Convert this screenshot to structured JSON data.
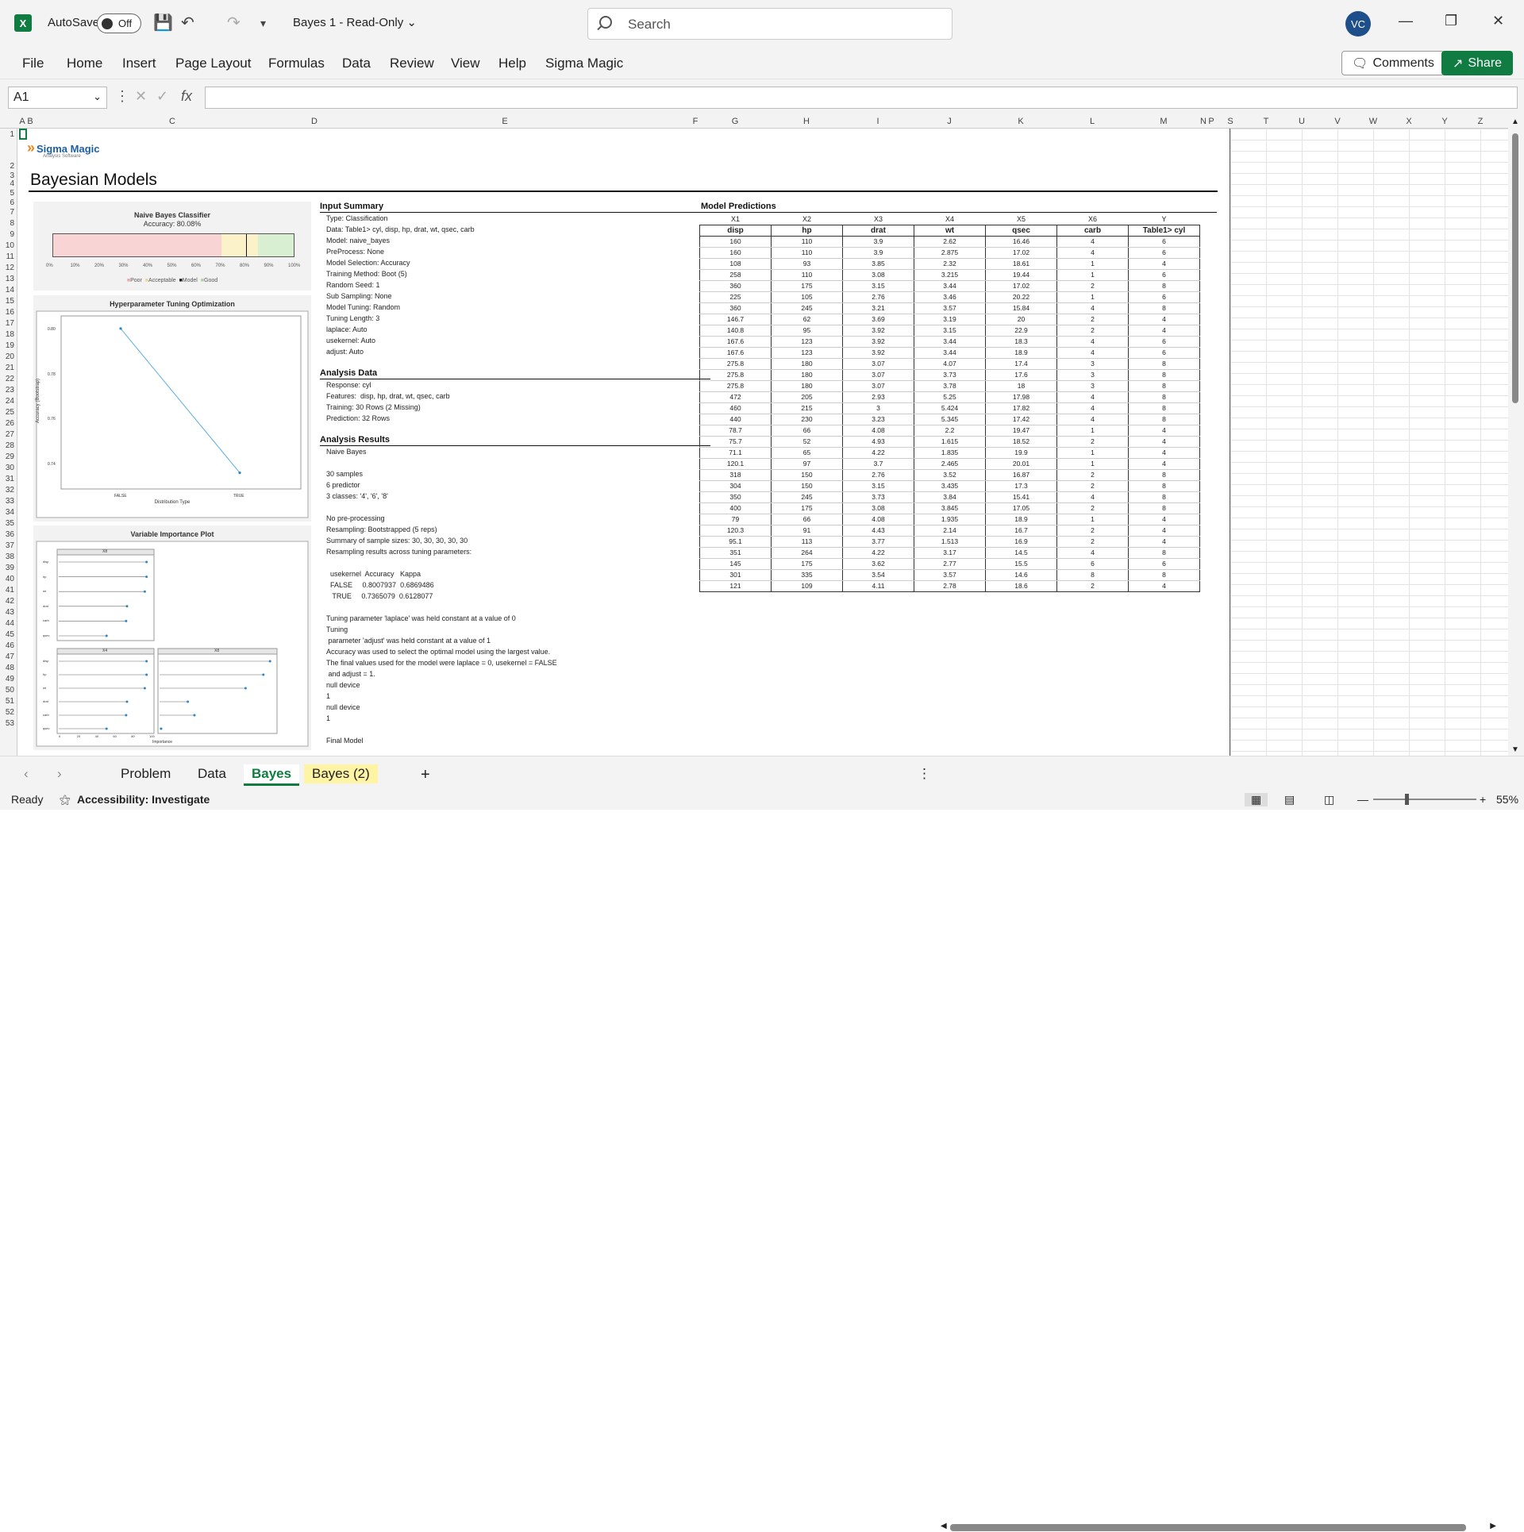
{
  "app": {
    "autosave_label": "AutoSave",
    "toggle_state": "Off",
    "doc_title": "Bayes 1  -  Read-Only",
    "search_placeholder": "Search",
    "user_initials": "VC"
  },
  "menu": [
    "File",
    "Home",
    "Insert",
    "Page Layout",
    "Formulas",
    "Data",
    "Review",
    "View",
    "Help",
    "Sigma Magic"
  ],
  "actions": {
    "comments": "Comments",
    "share": "Share"
  },
  "formula": {
    "cell": "A1",
    "fx": "fx",
    "value": ""
  },
  "columns": [
    "A",
    "B",
    "C",
    "D",
    "E",
    "F",
    "G",
    "H",
    "I",
    "J",
    "K",
    "L",
    "M",
    "N",
    "P",
    "S",
    "T",
    "U",
    "V",
    "W",
    "X",
    "Y",
    "Z"
  ],
  "rows": [
    "1",
    "2",
    "3",
    "4",
    "5",
    "6",
    "7",
    "8",
    "9",
    "10",
    "11",
    "12",
    "13",
    "14",
    "15",
    "16",
    "17",
    "18",
    "19",
    "20",
    "21",
    "22",
    "23",
    "24",
    "25",
    "26",
    "27",
    "28",
    "29",
    "30",
    "31",
    "32",
    "33",
    "34",
    "35",
    "36",
    "37",
    "38",
    "39",
    "40",
    "41",
    "42",
    "43",
    "44",
    "45",
    "46",
    "47",
    "48",
    "49",
    "50",
    "51",
    "52",
    "53"
  ],
  "sheet": {
    "logo_name": "Sigma Magic",
    "logo_sub": "Analysis Software",
    "title": "Bayesian Models",
    "gauge": {
      "title": "Naive Bayes Classifier",
      "subtitle": "Accuracy: 80.08%",
      "accuracy": 0.8008,
      "ticks": [
        "0%",
        "10%",
        "20%",
        "30%",
        "40%",
        "50%",
        "60%",
        "70%",
        "80%",
        "90%",
        "100%"
      ],
      "legend": [
        "Poor",
        "Acceptable",
        "Model",
        "Good"
      ]
    },
    "tuning_chart": {
      "title": "Hyperparameter Tuning Optimization",
      "xlabel": "Distribution Type",
      "ylabel": "Accuracy (Bootstrap)",
      "x": [
        "FALSE",
        "TRUE"
      ],
      "y": [
        0.8007937,
        0.7365079
      ],
      "yticks": [
        "0.80",
        "0.78",
        "0.76",
        "0.74"
      ]
    },
    "importance_chart": {
      "title": "Variable Importance Plot",
      "panels": [
        "X8",
        "X4",
        "X8"
      ],
      "vars": [
        "disp",
        "hp",
        "wt",
        "drat",
        "carb",
        "qsec"
      ],
      "xticks": [
        "0",
        "20",
        "40",
        "60",
        "80",
        "100"
      ],
      "xlabel": "Importance"
    },
    "input_summary": {
      "heading": "Input Summary",
      "lines": [
        "Type: Classification",
        "Data: Table1> cyl, disp, hp, drat, wt, qsec, carb",
        "Model: naive_bayes",
        "PreProcess: None",
        "Model Selection: Accuracy",
        "Training Method: Boot (5)",
        "Random Seed: 1",
        "Sub Sampling: None",
        "Model Tuning: Random",
        "Tuning Length: 3",
        "laplace: Auto",
        "usekernel: Auto",
        "adjust: Auto"
      ]
    },
    "analysis_data": {
      "heading": "Analysis Data",
      "lines": [
        "Response: cyl",
        "Features:  disp, hp, drat, wt, qsec, carb",
        "Training: 30 Rows (2 Missing)",
        "Prediction: 32 Rows"
      ]
    },
    "analysis_results": {
      "heading": "Analysis Results",
      "lines": [
        "Naive Bayes",
        "",
        "30 samples",
        "6 predictor",
        "3 classes: '4', '6', '8'",
        "",
        "No pre-processing",
        "Resampling: Bootstrapped (5 reps)",
        "Summary of sample sizes: 30, 30, 30, 30, 30",
        "Resampling results across tuning parameters:",
        "",
        "  usekernel  Accuracy   Kappa",
        "  FALSE     0.8007937  0.6869486",
        "   TRUE     0.7365079  0.6128077",
        "",
        "Tuning parameter 'laplace' was held constant at a value of 0",
        "Tuning",
        " parameter 'adjust' was held constant at a value of 1",
        "Accuracy was used to select the optimal model using the largest value.",
        "The final values used for the model were laplace = 0, usekernel = FALSE",
        " and adjust = 1.",
        "null device",
        "1",
        "null device",
        "1",
        "",
        "Final Model"
      ]
    },
    "predictions": {
      "heading": "Model Predictions",
      "codes": [
        "X1",
        "X2",
        "X3",
        "X4",
        "X5",
        "X6",
        "Y"
      ],
      "headers": [
        "disp",
        "hp",
        "drat",
        "wt",
        "qsec",
        "carb",
        "Table1> cyl"
      ],
      "rows": [
        [
          "160",
          "110",
          "3.9",
          "2.62",
          "16.46",
          "4",
          "6"
        ],
        [
          "160",
          "110",
          "3.9",
          "2.875",
          "17.02",
          "4",
          "6"
        ],
        [
          "108",
          "93",
          "3.85",
          "2.32",
          "18.61",
          "1",
          "4"
        ],
        [
          "258",
          "110",
          "3.08",
          "3.215",
          "19.44",
          "1",
          "6"
        ],
        [
          "360",
          "175",
          "3.15",
          "3.44",
          "17.02",
          "2",
          "8"
        ],
        [
          "225",
          "105",
          "2.76",
          "3.46",
          "20.22",
          "1",
          "6"
        ],
        [
          "360",
          "245",
          "3.21",
          "3.57",
          "15.84",
          "4",
          "8"
        ],
        [
          "146.7",
          "62",
          "3.69",
          "3.19",
          "20",
          "2",
          "4"
        ],
        [
          "140.8",
          "95",
          "3.92",
          "3.15",
          "22.9",
          "2",
          "4"
        ],
        [
          "167.6",
          "123",
          "3.92",
          "3.44",
          "18.3",
          "4",
          "6"
        ],
        [
          "167.6",
          "123",
          "3.92",
          "3.44",
          "18.9",
          "4",
          "6"
        ],
        [
          "275.8",
          "180",
          "3.07",
          "4.07",
          "17.4",
          "3",
          "8"
        ],
        [
          "275.8",
          "180",
          "3.07",
          "3.73",
          "17.6",
          "3",
          "8"
        ],
        [
          "275.8",
          "180",
          "3.07",
          "3.78",
          "18",
          "3",
          "8"
        ],
        [
          "472",
          "205",
          "2.93",
          "5.25",
          "17.98",
          "4",
          "8"
        ],
        [
          "460",
          "215",
          "3",
          "5.424",
          "17.82",
          "4",
          "8"
        ],
        [
          "440",
          "230",
          "3.23",
          "5.345",
          "17.42",
          "4",
          "8"
        ],
        [
          "78.7",
          "66",
          "4.08",
          "2.2",
          "19.47",
          "1",
          "4"
        ],
        [
          "75.7",
          "52",
          "4.93",
          "1.615",
          "18.52",
          "2",
          "4"
        ],
        [
          "71.1",
          "65",
          "4.22",
          "1.835",
          "19.9",
          "1",
          "4"
        ],
        [
          "120.1",
          "97",
          "3.7",
          "2.465",
          "20.01",
          "1",
          "4"
        ],
        [
          "318",
          "150",
          "2.76",
          "3.52",
          "16.87",
          "2",
          "8"
        ],
        [
          "304",
          "150",
          "3.15",
          "3.435",
          "17.3",
          "2",
          "8"
        ],
        [
          "350",
          "245",
          "3.73",
          "3.84",
          "15.41",
          "4",
          "8"
        ],
        [
          "400",
          "175",
          "3.08",
          "3.845",
          "17.05",
          "2",
          "8"
        ],
        [
          "79",
          "66",
          "4.08",
          "1.935",
          "18.9",
          "1",
          "4"
        ],
        [
          "120.3",
          "91",
          "4.43",
          "2.14",
          "16.7",
          "2",
          "4"
        ],
        [
          "95.1",
          "113",
          "3.77",
          "1.513",
          "16.9",
          "2",
          "4"
        ],
        [
          "351",
          "264",
          "4.22",
          "3.17",
          "14.5",
          "4",
          "8"
        ],
        [
          "145",
          "175",
          "3.62",
          "2.77",
          "15.5",
          "6",
          "6"
        ],
        [
          "301",
          "335",
          "3.54",
          "3.57",
          "14.6",
          "8",
          "8"
        ],
        [
          "121",
          "109",
          "4.11",
          "2.78",
          "18.6",
          "2",
          "4"
        ]
      ]
    }
  },
  "tabs": {
    "items": [
      "Problem",
      "Data",
      "Bayes",
      "Bayes (2)"
    ],
    "add": "+"
  },
  "status": {
    "ready": "Ready",
    "accessibility": "Accessibility: Investigate",
    "zoom": "55%"
  }
}
